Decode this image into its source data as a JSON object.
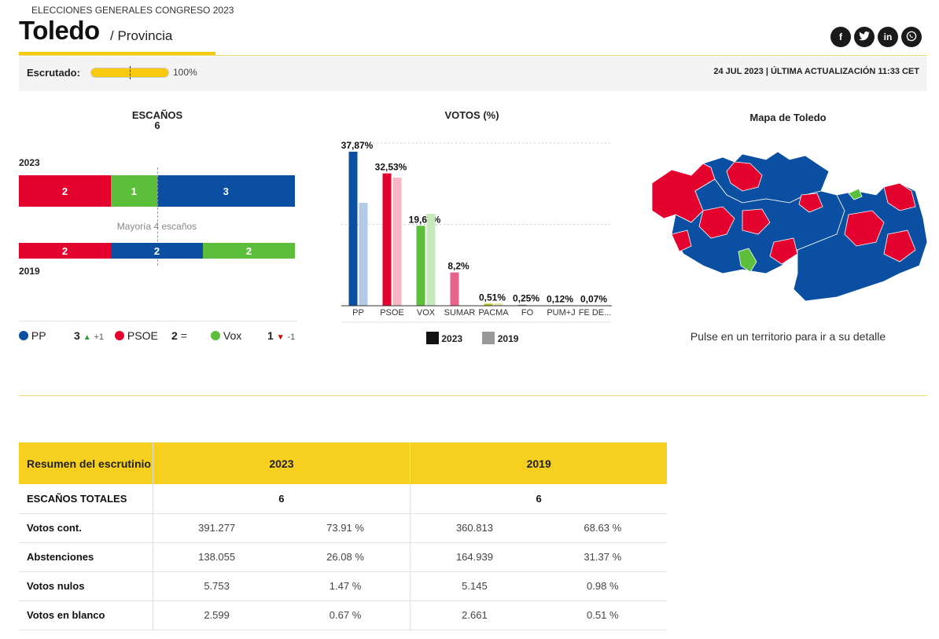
{
  "header": {
    "supertitle": "ELECCIONES GENERALES CONGRESO 2023",
    "title": "Toledo",
    "subtitle": "/ Provincia",
    "social": [
      "f",
      "t",
      "in",
      "w"
    ]
  },
  "status": {
    "label": "Escrutado:",
    "progress": 100,
    "progress_text": "100%",
    "update": "24 JUL 2023 | ÚLTIMA ACTUALIZACIÓN 11:33 CET"
  },
  "seats": {
    "title": "ESCAÑOS",
    "total": "6",
    "year_top": "2023",
    "year_bottom": "2019",
    "majority": "Mayoría 4 escaños",
    "bar2023": [
      {
        "party": "PSOE",
        "seats": 2,
        "color": "#e4032e"
      },
      {
        "party": "Vox",
        "seats": 1,
        "color": "#5bbf3b"
      },
      {
        "party": "PP",
        "seats": 3,
        "color": "#0b4fa3"
      }
    ],
    "bar2019": [
      {
        "party": "PSOE",
        "seats": 2,
        "color": "#e4032e"
      },
      {
        "party": "PP",
        "seats": 2,
        "color": "#0b4fa3"
      },
      {
        "party": "Vox",
        "seats": 2,
        "color": "#5bbf3b"
      }
    ],
    "legend": [
      {
        "party": "PP",
        "color": "#0b4fa3",
        "seats": "3",
        "arrow": "▲",
        "arrow_color": "#2e9a3a",
        "change": "+1"
      },
      {
        "party": "PSOE",
        "color": "#e4032e",
        "seats": "2",
        "arrow": "=",
        "arrow_color": "#333",
        "change": ""
      },
      {
        "party": "Vox",
        "color": "#5bbf3b",
        "seats": "1",
        "arrow": "▼",
        "arrow_color": "#c00",
        "change": "-1"
      }
    ]
  },
  "votes": {
    "title": "VOTOS (%)",
    "legend_2023": "2023",
    "legend_2019": "2019"
  },
  "chart_data": {
    "type": "bar",
    "categories": [
      "PP",
      "PSOE",
      "VOX",
      "SUMAR",
      "PACMA",
      "FO",
      "PUM+J",
      "FE DE..."
    ],
    "series": [
      {
        "name": "2023",
        "values": [
          37.87,
          32.53,
          19.66,
          8.2,
          0.51,
          0.25,
          0.12,
          0.07
        ]
      },
      {
        "name": "2019",
        "values": [
          25.3,
          31.5,
          22.6,
          null,
          0.6,
          null,
          0.15,
          0.1
        ]
      }
    ],
    "labels": [
      "37,87%",
      "32,53%",
      "19,66%",
      "8,2%",
      "0,51%",
      "0,25%",
      "0,12%",
      "0,07%"
    ],
    "colors": [
      "#0b4fa3",
      "#e4032e",
      "#5bbf3b",
      "#e8638a",
      "#b6c21a",
      "#888888",
      "#888888",
      "#888888"
    ],
    "colors_2019": [
      "#b3c9e6",
      "#f5b7c3",
      "#c8e8bd",
      "#f2c3d1",
      "#e0e6a4",
      "#cccccc",
      "#cccccc",
      "#cccccc"
    ],
    "ylim": [
      0,
      40
    ],
    "grid": true
  },
  "map": {
    "title": "Mapa de Toledo",
    "caption": "Pulse en un territorio para ir a su detalle"
  },
  "table": {
    "header": [
      "Resumen del escrutinio",
      "2023",
      "2019"
    ],
    "rows": [
      {
        "label": "ESCAÑOS TOTALES",
        "a": "6",
        "b": "6"
      },
      {
        "label": "Votos cont.",
        "a1": "391.277",
        "a2": "73.91 %",
        "b1": "360.813",
        "b2": "68.63 %"
      },
      {
        "label": "Abstenciones",
        "a1": "138.055",
        "a2": "26.08 %",
        "b1": "164.939",
        "b2": "31.37 %"
      },
      {
        "label": "Votos nulos",
        "a1": "5.753",
        "a2": "1.47 %",
        "b1": "5.145",
        "b2": "0.98 %"
      },
      {
        "label": "Votos en blanco",
        "a1": "2.599",
        "a2": "0.67 %",
        "b1": "2.661",
        "b2": "0.51 %"
      }
    ]
  }
}
